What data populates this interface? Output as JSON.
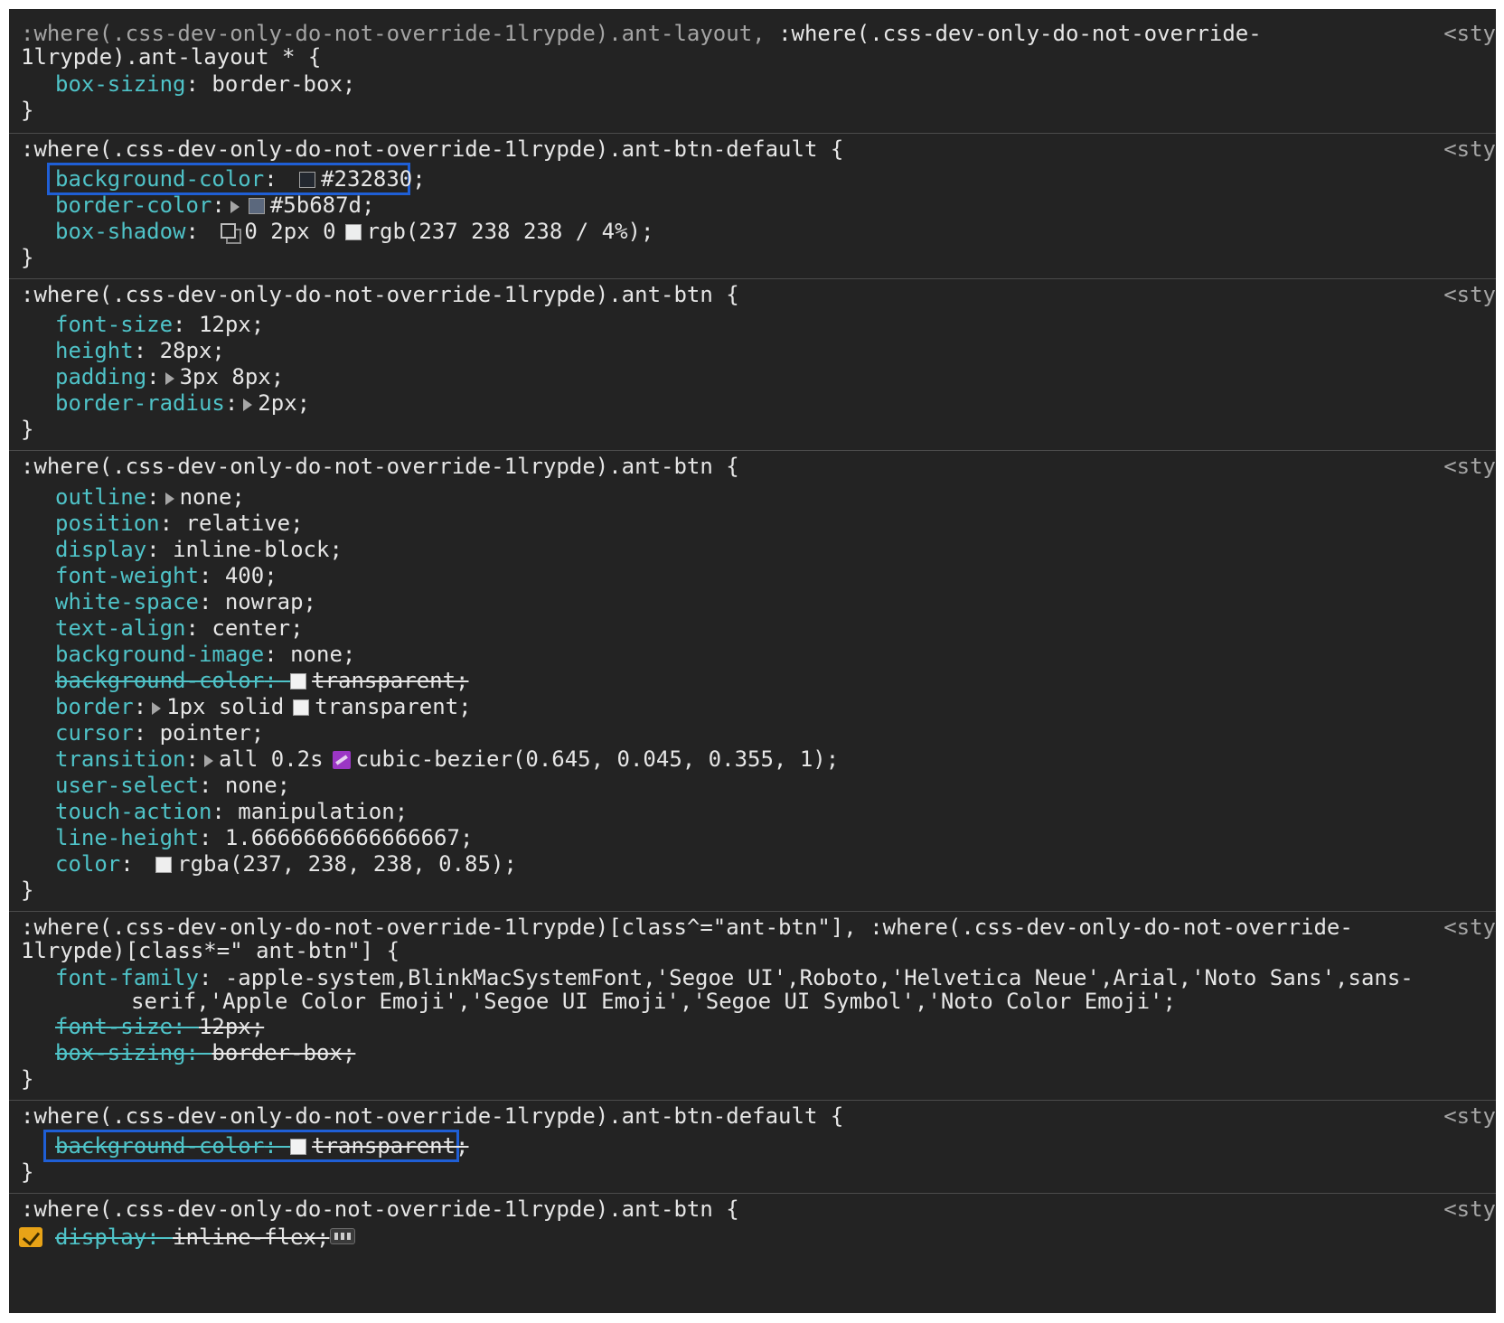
{
  "source_label": "<sty",
  "rules": [
    {
      "selector_dim": ":where(.css-dev-only-do-not-override-1lrypde).ant-layout,",
      "selector_line1": ":where(.css-dev-only-do-not-override-",
      "selector_line2": "1lrypde).ant-layout * {",
      "decls": [
        {
          "prop": "box-sizing",
          "value": "border-box;"
        }
      ]
    },
    {
      "selector": ":where(.css-dev-only-do-not-override-1lrypde).ant-btn-default {",
      "decls": [
        {
          "prop": "background-color",
          "value": "#232830;",
          "swatch": "#232830"
        },
        {
          "prop": "border-color",
          "value": "#5b687d;",
          "swatch": "#5b687d"
        },
        {
          "prop": "box-shadow",
          "value1": "0 2px 0",
          "value2": "rgb(237 238 238 / 4%);",
          "swatch": "#edeeee"
        }
      ]
    },
    {
      "selector": ":where(.css-dev-only-do-not-override-1lrypde).ant-btn {",
      "decls": [
        {
          "prop": "font-size",
          "value": "12px;"
        },
        {
          "prop": "height",
          "value": "28px;"
        },
        {
          "prop": "padding",
          "value": "3px 8px;"
        },
        {
          "prop": "border-radius",
          "value": "2px;"
        }
      ]
    },
    {
      "selector": ":where(.css-dev-only-do-not-override-1lrypde).ant-btn {",
      "decls": [
        {
          "prop": "outline",
          "value": "none;"
        },
        {
          "prop": "position",
          "value": "relative;"
        },
        {
          "prop": "display",
          "value": "inline-block;"
        },
        {
          "prop": "font-weight",
          "value": "400;"
        },
        {
          "prop": "white-space",
          "value": "nowrap;"
        },
        {
          "prop": "text-align",
          "value": "center;"
        },
        {
          "prop": "background-image",
          "value": "none;"
        },
        {
          "prop": "background-color",
          "value": "transparent;",
          "swatch": "#ffffff"
        },
        {
          "prop": "border",
          "value1": "1px solid",
          "value2": "transparent;",
          "swatch": "#ffffff"
        },
        {
          "prop": "cursor",
          "value": "pointer;"
        },
        {
          "prop": "transition",
          "value1": "all 0.2s",
          "value2": "cubic-bezier(0.645, 0.045, 0.355, 1);"
        },
        {
          "prop": "user-select",
          "value": "none;"
        },
        {
          "prop": "touch-action",
          "value": "manipulation;"
        },
        {
          "prop": "line-height",
          "value": "1.6666666666666667;"
        },
        {
          "prop": "color",
          "value": "rgba(237, 238, 238, 0.85);",
          "swatch": "#eeeeee"
        }
      ]
    },
    {
      "selector_line1": ":where(.css-dev-only-do-not-override-1lrypde)[class^=\"ant-btn\"], :where(.css-dev-only-do-not-override-",
      "selector_line2": "1lrypde)[class*=\" ant-btn\"] {",
      "decls": [
        {
          "prop": "font-family",
          "value": "-apple-system,BlinkMacSystemFont,'Segoe UI',Roboto,'Helvetica Neue',Arial,'Noto Sans',sans-",
          "value_cont": "serif,'Apple Color Emoji','Segoe UI Emoji','Segoe UI Symbol','Noto Color Emoji';"
        },
        {
          "prop": "font-size",
          "value": "12px;"
        },
        {
          "prop": "box-sizing",
          "value": "border-box;"
        }
      ]
    },
    {
      "selector": ":where(.css-dev-only-do-not-override-1lrypde).ant-btn-default {",
      "decls": [
        {
          "prop": "background-color",
          "value": "transparent;",
          "swatch": "#ffffff"
        }
      ]
    },
    {
      "selector": ":where(.css-dev-only-do-not-override-1lrypde).ant-btn {",
      "decls": [
        {
          "prop": "display",
          "value": "inline-flex;"
        }
      ]
    }
  ],
  "brace_close": "}",
  "colon": ": ",
  "colon_tri": ":"
}
